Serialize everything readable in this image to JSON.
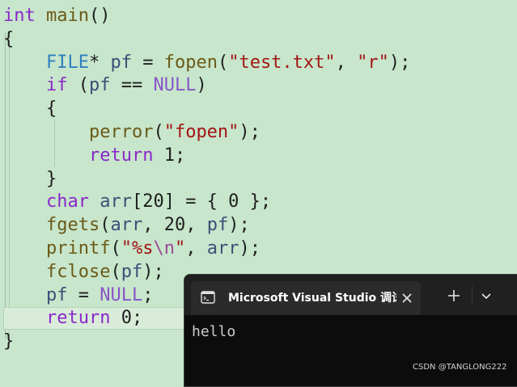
{
  "editor": {
    "lines": [
      {
        "parts": [
          {
            "t": "int",
            "c": "kw"
          },
          {
            "t": " ",
            "c": "pun"
          },
          {
            "t": "main",
            "c": "fn"
          },
          {
            "t": "()",
            "c": "pun"
          }
        ]
      },
      {
        "parts": [
          {
            "t": "{",
            "c": "pun"
          }
        ]
      },
      {
        "parts": [
          {
            "t": "    ",
            "c": "pun"
          },
          {
            "t": "FILE",
            "c": "ty"
          },
          {
            "t": "* ",
            "c": "pun"
          },
          {
            "t": "pf",
            "c": "var"
          },
          {
            "t": " = ",
            "c": "pun"
          },
          {
            "t": "fopen",
            "c": "fn"
          },
          {
            "t": "(",
            "c": "pun"
          },
          {
            "t": "\"test.txt\"",
            "c": "str"
          },
          {
            "t": ", ",
            "c": "pun"
          },
          {
            "t": "\"r\"",
            "c": "str"
          },
          {
            "t": ");",
            "c": "pun"
          }
        ]
      },
      {
        "parts": [
          {
            "t": "    ",
            "c": "pun"
          },
          {
            "t": "if",
            "c": "kw"
          },
          {
            "t": " (",
            "c": "pun"
          },
          {
            "t": "pf",
            "c": "var"
          },
          {
            "t": " == ",
            "c": "pun"
          },
          {
            "t": "NULL",
            "c": "mac"
          },
          {
            "t": ")",
            "c": "pun"
          }
        ]
      },
      {
        "parts": [
          {
            "t": "    {",
            "c": "pun"
          }
        ]
      },
      {
        "parts": [
          {
            "t": "        ",
            "c": "pun"
          },
          {
            "t": "perror",
            "c": "fn"
          },
          {
            "t": "(",
            "c": "pun"
          },
          {
            "t": "\"fopen\"",
            "c": "str"
          },
          {
            "t": ");",
            "c": "pun"
          }
        ]
      },
      {
        "parts": [
          {
            "t": "        ",
            "c": "pun"
          },
          {
            "t": "return",
            "c": "kw"
          },
          {
            "t": " ",
            "c": "pun"
          },
          {
            "t": "1",
            "c": "num"
          },
          {
            "t": ";",
            "c": "pun"
          }
        ]
      },
      {
        "parts": [
          {
            "t": "    }",
            "c": "pun"
          }
        ]
      },
      {
        "parts": [
          {
            "t": "    ",
            "c": "pun"
          },
          {
            "t": "char",
            "c": "kw"
          },
          {
            "t": " ",
            "c": "pun"
          },
          {
            "t": "arr",
            "c": "var"
          },
          {
            "t": "[20] = { 0 };",
            "c": "pun"
          }
        ]
      },
      {
        "parts": [
          {
            "t": "    ",
            "c": "pun"
          },
          {
            "t": "fgets",
            "c": "fn"
          },
          {
            "t": "(",
            "c": "pun"
          },
          {
            "t": "arr",
            "c": "var"
          },
          {
            "t": ", 20, ",
            "c": "pun"
          },
          {
            "t": "pf",
            "c": "var"
          },
          {
            "t": ");",
            "c": "pun"
          }
        ]
      },
      {
        "parts": [
          {
            "t": "    ",
            "c": "pun"
          },
          {
            "t": "printf",
            "c": "fn"
          },
          {
            "t": "(",
            "c": "pun"
          },
          {
            "t": "\"%s",
            "c": "str"
          },
          {
            "t": "\\n",
            "c": "esc"
          },
          {
            "t": "\"",
            "c": "str"
          },
          {
            "t": ", ",
            "c": "pun"
          },
          {
            "t": "arr",
            "c": "var"
          },
          {
            "t": ");",
            "c": "pun"
          }
        ]
      },
      {
        "parts": [
          {
            "t": "    ",
            "c": "pun"
          },
          {
            "t": "fclose",
            "c": "fn"
          },
          {
            "t": "(",
            "c": "pun"
          },
          {
            "t": "pf",
            "c": "var"
          },
          {
            "t": ");",
            "c": "pun"
          }
        ]
      },
      {
        "parts": [
          {
            "t": "    ",
            "c": "pun"
          },
          {
            "t": "pf",
            "c": "var"
          },
          {
            "t": " = ",
            "c": "pun"
          },
          {
            "t": "NULL",
            "c": "mac"
          },
          {
            "t": ";",
            "c": "pun"
          }
        ]
      },
      {
        "parts": [
          {
            "t": "    ",
            "c": "pun"
          },
          {
            "t": "return",
            "c": "kw"
          },
          {
            "t": " ",
            "c": "pun"
          },
          {
            "t": "0",
            "c": "num"
          },
          {
            "t": ";",
            "c": "pun"
          }
        ]
      },
      {
        "parts": [
          {
            "t": "}",
            "c": "pun"
          }
        ]
      }
    ]
  },
  "terminal": {
    "title": "Microsoft Visual Studio 调试控制台",
    "icon": "console-icon",
    "output": "hello"
  },
  "watermark": "CSDN @TANGLONG222",
  "colors": {
    "editor_background": "#c7e6cb",
    "terminal_background": "#0c0c0c"
  }
}
